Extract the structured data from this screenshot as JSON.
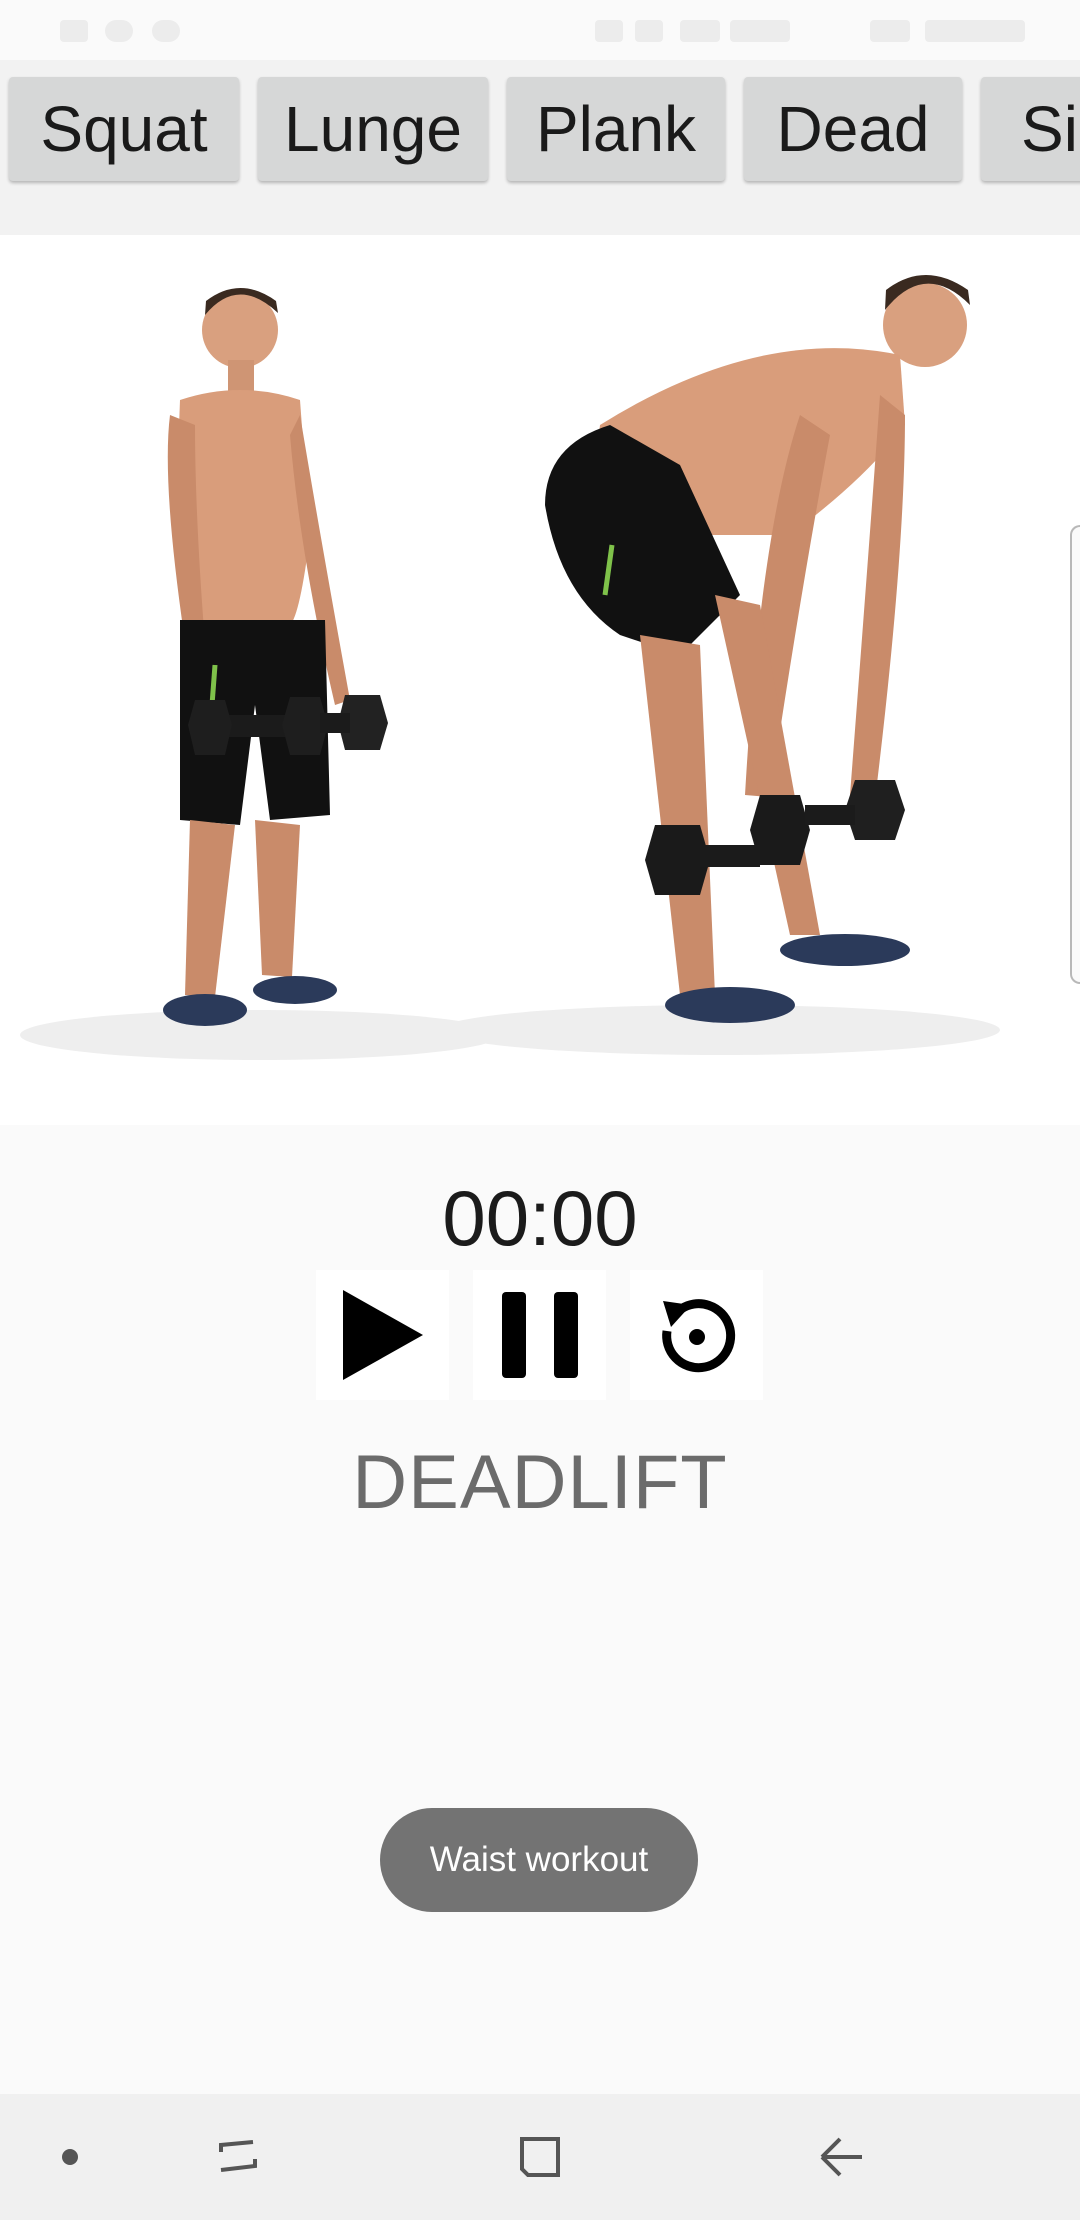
{
  "exercise_tabs": [
    "Squat",
    "Lunge",
    "Plank",
    "Dead",
    "Si"
  ],
  "timer": {
    "value": "00:00"
  },
  "controls": {
    "play_icon": "play-icon",
    "pause_icon": "pause-icon",
    "reset_icon": "replay-icon"
  },
  "exercise": {
    "name": "DEADLIFT"
  },
  "toast": {
    "message": "Waist workout"
  },
  "navbar": {
    "icons": [
      "dot-icon",
      "recents-icon",
      "home-icon",
      "back-icon"
    ]
  },
  "colors": {
    "chip_bg": "#d6d7d7",
    "toast_bg": "#737373",
    "page_bg": "#fafafa"
  }
}
